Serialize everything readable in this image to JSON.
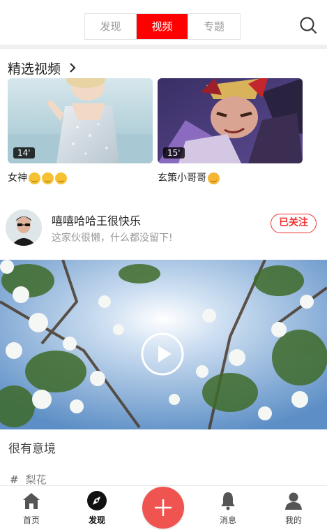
{
  "header": {
    "tabs": [
      {
        "label": "发现",
        "active": false
      },
      {
        "label": "视频",
        "active": true
      },
      {
        "label": "专题",
        "active": false
      }
    ],
    "search_icon": "search-icon",
    "accent_color": "#ff0000"
  },
  "featured": {
    "title": "精选视频",
    "cards": [
      {
        "duration": "14'",
        "caption": "女神",
        "emoji_count": 3
      },
      {
        "duration": "15'",
        "caption": "玄策小哥哥",
        "emoji_count": 1
      }
    ]
  },
  "post": {
    "user_name": "嘻嘻哈哈王很快乐",
    "user_bio": "这家伙很懒，什么都没留下!",
    "follow_label": "已关注",
    "video_title": "很有意境",
    "tag": "梨花"
  },
  "bottom_nav": {
    "items": [
      {
        "label": "首页",
        "icon": "home-icon",
        "active": false
      },
      {
        "label": "发现",
        "icon": "compass-icon",
        "active": true
      },
      {
        "label": "消息",
        "icon": "bell-icon",
        "active": false
      },
      {
        "label": "我的",
        "icon": "user-icon",
        "active": false
      }
    ],
    "fab_icon": "plus-icon",
    "fab_color": "#ef5450"
  }
}
